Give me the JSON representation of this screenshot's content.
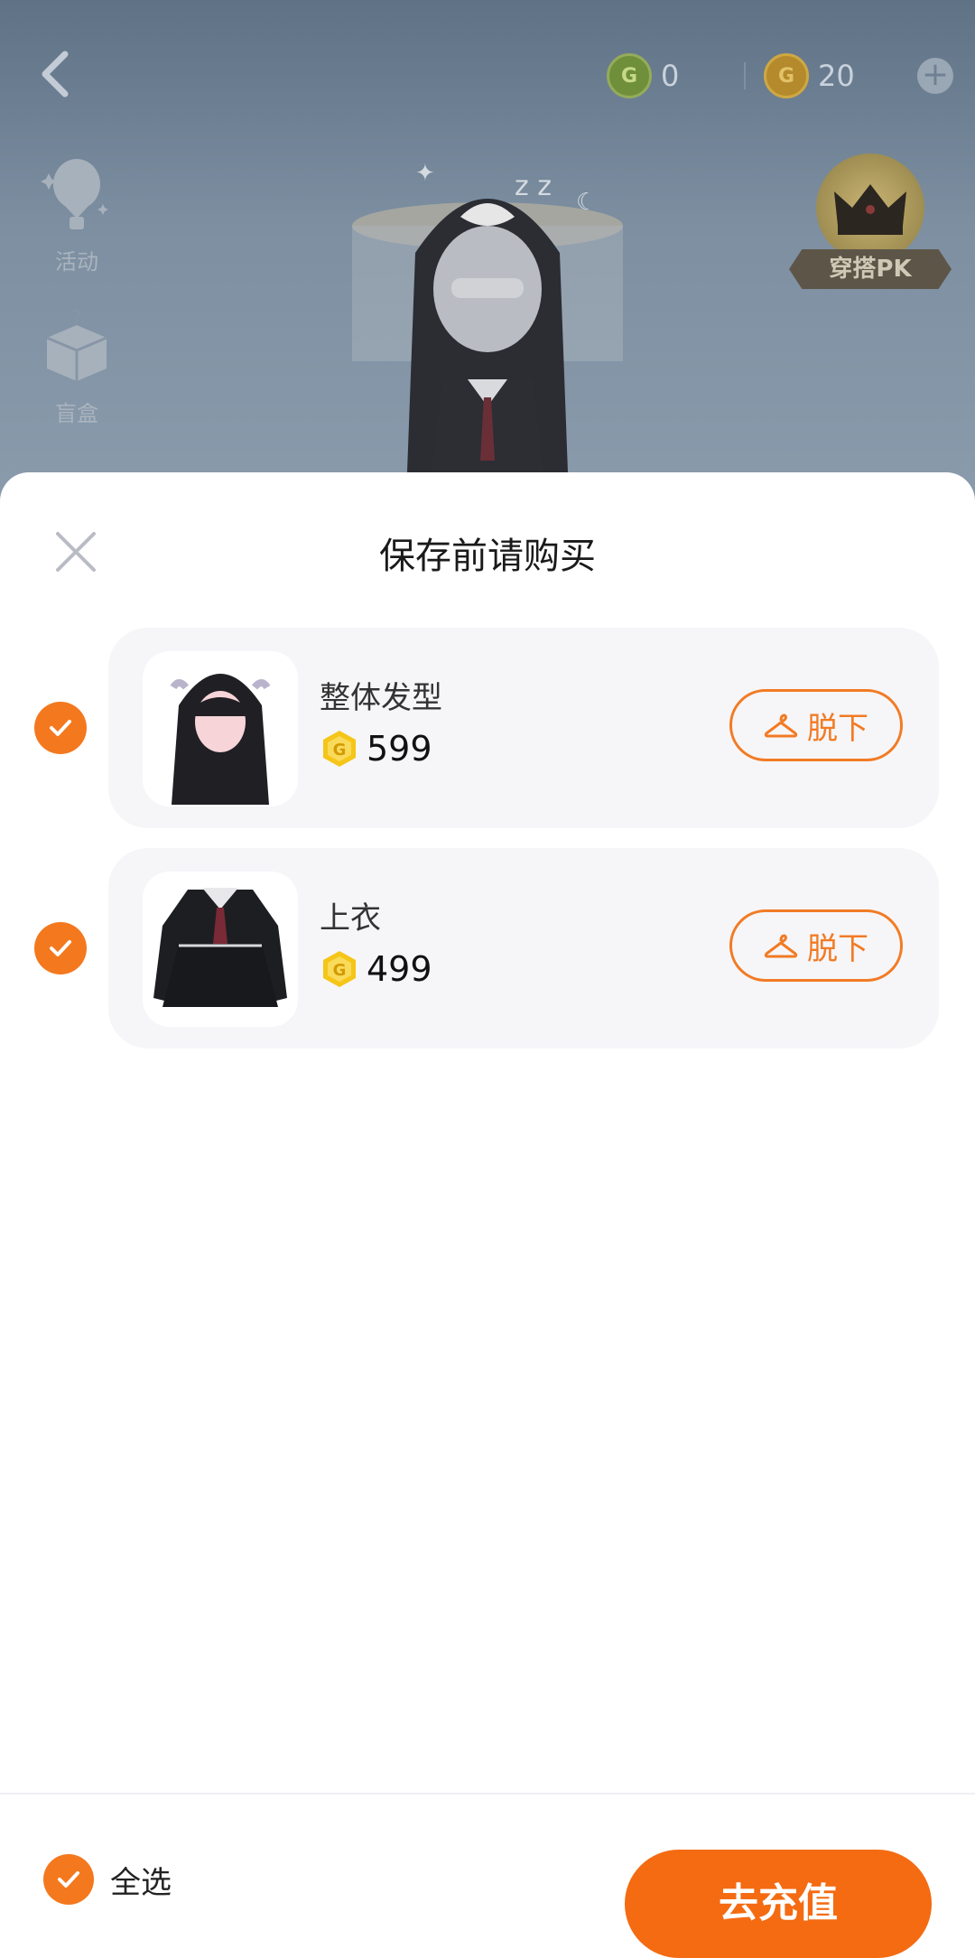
{
  "top_bar": {
    "green_currency_value": "0",
    "gold_currency_value": "20"
  },
  "side_menu": {
    "activity_label": "活动",
    "blind_box_label": "盲盒"
  },
  "pk_badge": {
    "label": "穿搭PK"
  },
  "sheet": {
    "title": "保存前请购买",
    "items": [
      {
        "name": "整体发型",
        "price": "599",
        "action_label": "脱下",
        "checked": true
      },
      {
        "name": "上衣",
        "price": "499",
        "action_label": "脱下",
        "checked": true
      }
    ],
    "select_all_label": "全选",
    "recharge_label": "去充值"
  },
  "colors": {
    "accent": "#f4781e",
    "coin": "#f5c518"
  }
}
